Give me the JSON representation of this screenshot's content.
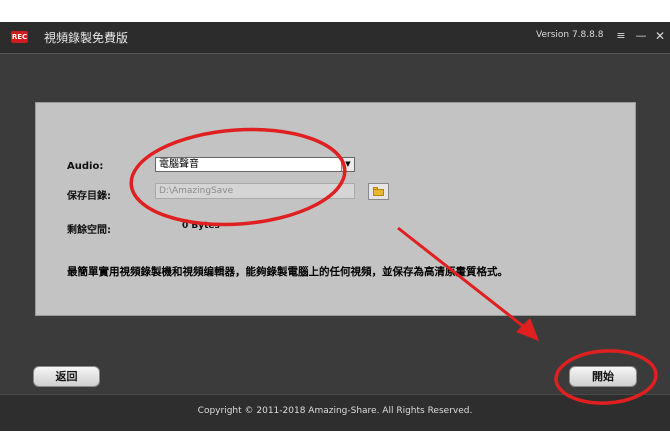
{
  "window": {
    "logo_text": "REC",
    "title": "視頻錄製免費版",
    "version": "Version 7.8.8.8",
    "menu_icon": "≡",
    "minimize_icon": "—",
    "close_icon": "✕"
  },
  "form": {
    "audio_label": "Audio:",
    "audio_value": "電腦聲音",
    "savedir_label": "保存目錄:",
    "savedir_value": "D:\\AmazingSave",
    "space_label": "剩餘空間:",
    "space_value": "0 Bytes",
    "description": "最簡單實用視頻錄製機和視頻编輯器，能夠錄製電腦上的任何視頻，並保存為高清原畫質格式。"
  },
  "buttons": {
    "back": "返回",
    "start": "開始"
  },
  "footer": {
    "copyright": "Copyright © 2011-2018 Amazing-Share. All Rights Reserved."
  },
  "colors": {
    "background": "#3b3b3b",
    "panel": "#c3c3c3",
    "annotation": "#e02020",
    "logo": "#d01c1c"
  }
}
